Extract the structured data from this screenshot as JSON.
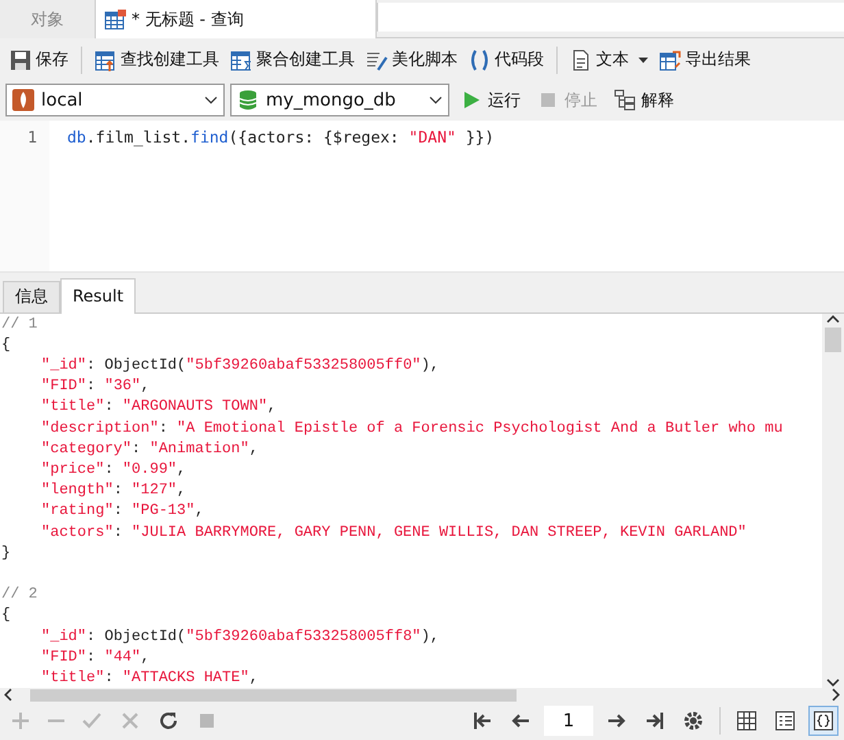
{
  "tabs": [
    {
      "label": "对象",
      "selected": false
    },
    {
      "label": "* 无标题 - 查询",
      "selected": true
    }
  ],
  "toolbar_groups": [
    [
      {
        "label": "保存",
        "dropdown": false
      }
    ],
    [
      {
        "label": "查找创建工具",
        "dropdown": false
      },
      {
        "label": "聚合创建工具",
        "dropdown": false
      },
      {
        "label": "美化脚本",
        "dropdown": false
      },
      {
        "label": "代码段",
        "dropdown": false
      }
    ],
    [
      {
        "label": "文本",
        "dropdown": true
      },
      {
        "label": "导出结果",
        "dropdown": false
      }
    ]
  ],
  "connection": {
    "server": "local",
    "database": "my_mongo_db"
  },
  "actions": [
    {
      "label": "运行",
      "disabled": false
    },
    {
      "label": "停止",
      "disabled": true
    },
    {
      "label": "解释",
      "disabled": false
    }
  ],
  "editor": {
    "lines": [
      {
        "number": "1",
        "segments": [
          {
            "text": "db",
            "kind": "ident"
          },
          {
            "text": ".film_list.",
            "kind": "plain"
          },
          {
            "text": "find",
            "kind": "ident"
          },
          {
            "text": "({actors: {$regex: ",
            "kind": "plain"
          },
          {
            "text": "\"DAN\"",
            "kind": "string"
          },
          {
            "text": " }})",
            "kind": "plain"
          }
        ]
      }
    ]
  },
  "result_tabs": [
    {
      "label": "信息",
      "selected": false
    },
    {
      "label": "Result",
      "selected": true
    }
  ],
  "result": {
    "lines": [
      {
        "kind": "top",
        "segments": [
          {
            "text": "// 1",
            "kind": "comment"
          }
        ]
      },
      {
        "kind": "top",
        "segments": [
          {
            "text": "{",
            "kind": "plain"
          }
        ]
      },
      {
        "kind": "field",
        "segments": [
          {
            "text": "\"_id\"",
            "kind": "key"
          },
          {
            "text": ": ObjectId(",
            "kind": "plain"
          },
          {
            "text": "\"5bf39260abaf533258005ff0\"",
            "kind": "string"
          },
          {
            "text": "),",
            "kind": "plain"
          }
        ]
      },
      {
        "kind": "field",
        "segments": [
          {
            "text": "\"FID\"",
            "kind": "key"
          },
          {
            "text": ": ",
            "kind": "plain"
          },
          {
            "text": "\"36\"",
            "kind": "string"
          },
          {
            "text": ",",
            "kind": "plain"
          }
        ]
      },
      {
        "kind": "field",
        "segments": [
          {
            "text": "\"title\"",
            "kind": "key"
          },
          {
            "text": ": ",
            "kind": "plain"
          },
          {
            "text": "\"ARGONAUTS TOWN\"",
            "kind": "string"
          },
          {
            "text": ",",
            "kind": "plain"
          }
        ]
      },
      {
        "kind": "field",
        "segments": [
          {
            "text": "\"description\"",
            "kind": "key"
          },
          {
            "text": ": ",
            "kind": "plain"
          },
          {
            "text": "\"A Emotional Epistle of a Forensic Psychologist And a Butler who mu",
            "kind": "string"
          }
        ]
      },
      {
        "kind": "field",
        "segments": [
          {
            "text": "\"category\"",
            "kind": "key"
          },
          {
            "text": ": ",
            "kind": "plain"
          },
          {
            "text": "\"Animation\"",
            "kind": "string"
          },
          {
            "text": ",",
            "kind": "plain"
          }
        ]
      },
      {
        "kind": "field",
        "segments": [
          {
            "text": "\"price\"",
            "kind": "key"
          },
          {
            "text": ": ",
            "kind": "plain"
          },
          {
            "text": "\"0.99\"",
            "kind": "string"
          },
          {
            "text": ",",
            "kind": "plain"
          }
        ]
      },
      {
        "kind": "field",
        "segments": [
          {
            "text": "\"length\"",
            "kind": "key"
          },
          {
            "text": ": ",
            "kind": "plain"
          },
          {
            "text": "\"127\"",
            "kind": "string"
          },
          {
            "text": ",",
            "kind": "plain"
          }
        ]
      },
      {
        "kind": "field",
        "segments": [
          {
            "text": "\"rating\"",
            "kind": "key"
          },
          {
            "text": ": ",
            "kind": "plain"
          },
          {
            "text": "\"PG-13\"",
            "kind": "string"
          },
          {
            "text": ",",
            "kind": "plain"
          }
        ]
      },
      {
        "kind": "field",
        "segments": [
          {
            "text": "\"actors\"",
            "kind": "key"
          },
          {
            "text": ": ",
            "kind": "plain"
          },
          {
            "text": "\"JULIA BARRYMORE, GARY PENN, GENE WILLIS, DAN STREEP, KEVIN GARLAND\"",
            "kind": "string"
          }
        ]
      },
      {
        "kind": "top",
        "segments": [
          {
            "text": "}",
            "kind": "plain"
          }
        ]
      },
      {
        "kind": "blank"
      },
      {
        "kind": "top",
        "segments": [
          {
            "text": "// 2",
            "kind": "comment"
          }
        ]
      },
      {
        "kind": "top",
        "segments": [
          {
            "text": "{",
            "kind": "plain"
          }
        ]
      },
      {
        "kind": "field",
        "segments": [
          {
            "text": "\"_id\"",
            "kind": "key"
          },
          {
            "text": ": ObjectId(",
            "kind": "plain"
          },
          {
            "text": "\"5bf39260abaf533258005ff8\"",
            "kind": "string"
          },
          {
            "text": "),",
            "kind": "plain"
          }
        ]
      },
      {
        "kind": "field",
        "segments": [
          {
            "text": "\"FID\"",
            "kind": "key"
          },
          {
            "text": ": ",
            "kind": "plain"
          },
          {
            "text": "\"44\"",
            "kind": "string"
          },
          {
            "text": ",",
            "kind": "plain"
          }
        ]
      },
      {
        "kind": "field",
        "segments": [
          {
            "text": "\"title\"",
            "kind": "key"
          },
          {
            "text": ": ",
            "kind": "plain"
          },
          {
            "text": "\"ATTACKS HATE\"",
            "kind": "string"
          },
          {
            "text": ",",
            "kind": "plain"
          }
        ]
      }
    ]
  },
  "footer": {
    "edit_buttons": [
      {
        "disabled": true
      },
      {
        "disabled": true
      },
      {
        "disabled": true
      },
      {
        "disabled": true
      },
      {
        "disabled": false
      },
      {
        "disabled": true
      }
    ],
    "page": "1",
    "views": [
      {
        "selected": false
      },
      {
        "selected": false
      },
      {
        "selected": true
      }
    ]
  }
}
